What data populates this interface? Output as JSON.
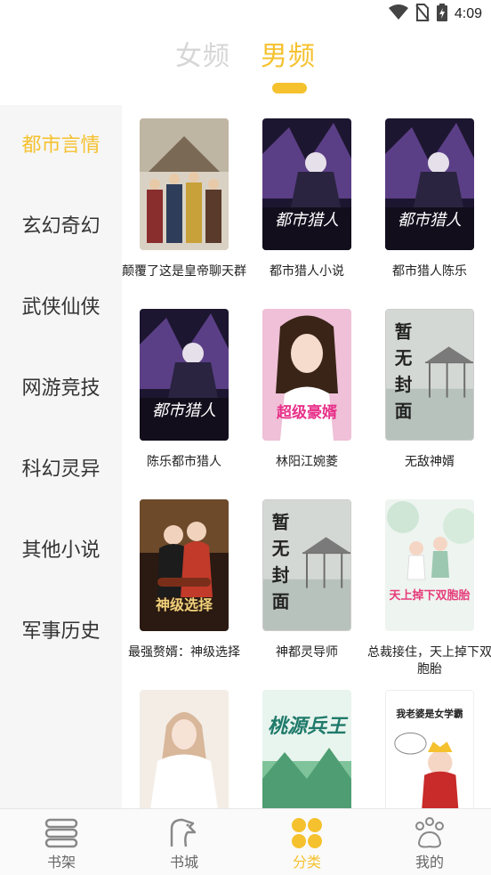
{
  "status_bar": {
    "time": "4:09",
    "icons": [
      "wifi-icon",
      "no-sim-icon",
      "battery-icon"
    ]
  },
  "gender_tabs": [
    {
      "label": "女频",
      "active": false
    },
    {
      "label": "男频",
      "active": true
    }
  ],
  "categories": [
    {
      "label": "都市言情",
      "active": true
    },
    {
      "label": "玄幻奇幻",
      "active": false
    },
    {
      "label": "武侠仙侠",
      "active": false
    },
    {
      "label": "网游竞技",
      "active": false
    },
    {
      "label": "科幻灵异",
      "active": false
    },
    {
      "label": "其他小说",
      "active": false
    },
    {
      "label": "军事历史",
      "active": false
    }
  ],
  "books": [
    {
      "title": "颠覆了这是皇帝聊天群",
      "cover": "palace-cover",
      "cover_text": ""
    },
    {
      "title": "都市猎人小说",
      "cover": "dark-hunter-cover",
      "cover_text": "都市猎人"
    },
    {
      "title": "都市猎人陈乐",
      "cover": "dark-hunter-cover",
      "cover_text": "都市猎人"
    },
    {
      "title": "陈乐都市猎人",
      "cover": "dark-hunter-cover",
      "cover_text": "都市猎人"
    },
    {
      "title": "林阳江婉菱",
      "cover": "pink-portrait-cover",
      "cover_text": "超级豪婿"
    },
    {
      "title": "无敌神婿",
      "cover": "no-cover-placeholder",
      "cover_text": "暂无封面"
    },
    {
      "title": "最强赘婿：神级选择",
      "cover": "couple-cover",
      "cover_text": "神级选择"
    },
    {
      "title": "神都灵导师",
      "cover": "no-cover-placeholder",
      "cover_text": "暂无封面"
    },
    {
      "title": "总裁接住，天上掉下双胞胎",
      "cover": "twins-cover",
      "cover_text": "天上掉下双胞胎"
    },
    {
      "title": "",
      "cover": "bride-cover",
      "cover_text": ""
    },
    {
      "title": "",
      "cover": "landscape-cover",
      "cover_text": "桃源兵王"
    },
    {
      "title": "",
      "cover": "comic-cover",
      "cover_text": "我老婆是女学霸"
    }
  ],
  "tab_bar": [
    {
      "label": "书架",
      "icon": "bookshelf-icon",
      "active": false
    },
    {
      "label": "书城",
      "icon": "bookstore-icon",
      "active": false
    },
    {
      "label": "分类",
      "icon": "category-icon",
      "active": true
    },
    {
      "label": "我的",
      "icon": "paw-profile-icon",
      "active": false
    }
  ],
  "colors": {
    "accent": "#f5c12e",
    "sidebar_bg": "#f6f6f6",
    "text": "#333333",
    "inactive_tab": "#d6d6d6"
  }
}
